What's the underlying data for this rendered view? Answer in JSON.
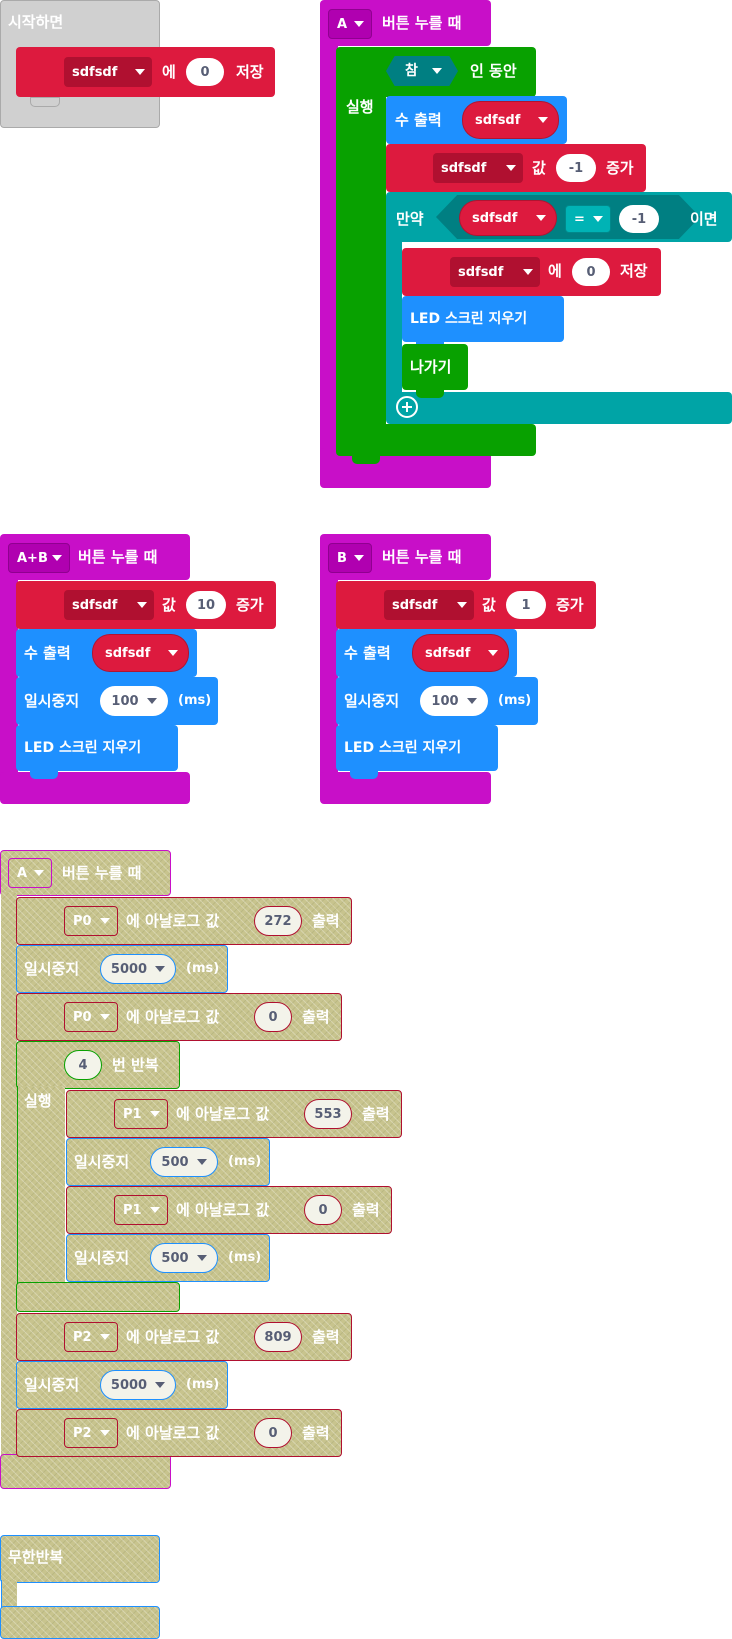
{
  "colors": {
    "basic_event": "#c80fc8",
    "variables": "#dd1a3e",
    "basic": "#1e90ff",
    "loops": "#08a100",
    "logic": "#00a4a6",
    "disabled": "#c8c48e"
  },
  "on_start": {
    "label": "시작하면",
    "set": {
      "var": "sdfsdf",
      "to": "에",
      "value": "0",
      "store": "저장"
    }
  },
  "button_a": {
    "button": "A",
    "event": "버튼 누를 때",
    "while": {
      "cond": "참",
      "label": "인 동안",
      "do": "실행"
    },
    "show_number": {
      "label": "수 출력",
      "var": "sdfsdf"
    },
    "change": {
      "var": "sdfsdf",
      "by": "값",
      "value": "-1",
      "inc": "증가"
    },
    "if": {
      "label": "만약",
      "var": "sdfsdf",
      "op": "=",
      "value": "-1",
      "then": "이면"
    },
    "set": {
      "var": "sdfsdf",
      "to": "에",
      "value": "0",
      "store": "저장"
    },
    "clear": "LED 스크린 지우기",
    "break": "나가기",
    "plus_icon": "plus-circle-icon"
  },
  "button_ab": {
    "button": "A+B",
    "event": "버튼 누를 때",
    "change": {
      "var": "sdfsdf",
      "by": "값",
      "value": "10",
      "inc": "증가"
    },
    "show_number": {
      "label": "수 출력",
      "var": "sdfsdf"
    },
    "pause": {
      "label": "일시중지",
      "value": "100",
      "unit": "(ms)"
    },
    "clear": "LED 스크린 지우기"
  },
  "button_b": {
    "button": "B",
    "event": "버튼 누를 때",
    "change": {
      "var": "sdfsdf",
      "by": "값",
      "value": "1",
      "inc": "증가"
    },
    "show_number": {
      "label": "수 출력",
      "var": "sdfsdf"
    },
    "pause": {
      "label": "일시중지",
      "value": "100",
      "unit": "(ms)"
    },
    "clear": "LED 스크린 지우기"
  },
  "disabled_a": {
    "button": "A",
    "event": "버튼 누를 때",
    "analog_label": "에 아날로그 값",
    "write": "출력",
    "pause_label": "일시중지",
    "unit": "(ms)",
    "rows": [
      {
        "pin": "P0",
        "value": "272"
      },
      {
        "pause": "5000"
      },
      {
        "pin": "P0",
        "value": "0"
      }
    ],
    "repeat": {
      "count": "4",
      "label": "번 반복",
      "do": "실행"
    },
    "inner": [
      {
        "pin": "P1",
        "value": "553"
      },
      {
        "pause": "500"
      },
      {
        "pin": "P1",
        "value": "0"
      },
      {
        "pause": "500"
      }
    ],
    "after": [
      {
        "pin": "P2",
        "value": "809"
      },
      {
        "pause": "5000"
      },
      {
        "pin": "P2",
        "value": "0"
      }
    ]
  },
  "forever": {
    "label": "무한반복"
  }
}
